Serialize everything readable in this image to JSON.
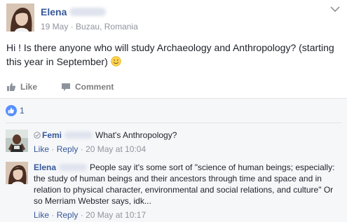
{
  "post": {
    "author_first": "Elena",
    "date": "19 May",
    "location": "Buzau, Romania",
    "text": "Hi ! Is there anyone who will study Archaeology and Anthropology? (starting this year in September)",
    "emoji_icon": "smile-emoji-icon",
    "actions": {
      "like": "Like",
      "comment": "Comment"
    }
  },
  "reactions": {
    "count": "1",
    "icon": "like-reaction-icon",
    "color": "#5890ff"
  },
  "comments": [
    {
      "author_first": "Femi",
      "text": "What's Anthropology?",
      "actions": {
        "like": "Like",
        "reply": "Reply",
        "time": "20 May at 10:04"
      }
    },
    {
      "author_first": "Elena",
      "text": "People say it's some sort of \"science of human beings; especially: the study of human beings and their ancestors through time and space and in relation to physical character, environmental and social relations, and culture\" Or so Merriam Webster says, idk...",
      "actions": {
        "like": "Like",
        "reply": "Reply",
        "time": "20 May at 10:17"
      }
    }
  ],
  "colors": {
    "link": "#365899",
    "meta": "#90949c",
    "text": "#1d2129",
    "panel": "#f6f7f9"
  }
}
